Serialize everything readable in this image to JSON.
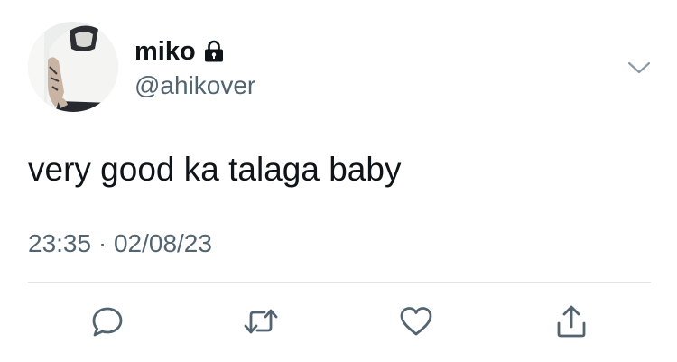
{
  "user": {
    "display_name": "miko",
    "handle": "@ahikover",
    "protected_icon": "lock-icon"
  },
  "tweet": {
    "text": "very good ka talaga baby",
    "timestamp": "23:35 · 02/08/23"
  },
  "actions": [
    {
      "icon": "reply-icon"
    },
    {
      "icon": "retweet-icon"
    },
    {
      "icon": "like-icon"
    },
    {
      "icon": "share-icon"
    }
  ],
  "colors": {
    "text_primary": "#0f1419",
    "text_secondary": "#536471",
    "icon": "#536471",
    "divider": "#dfe3e6"
  }
}
